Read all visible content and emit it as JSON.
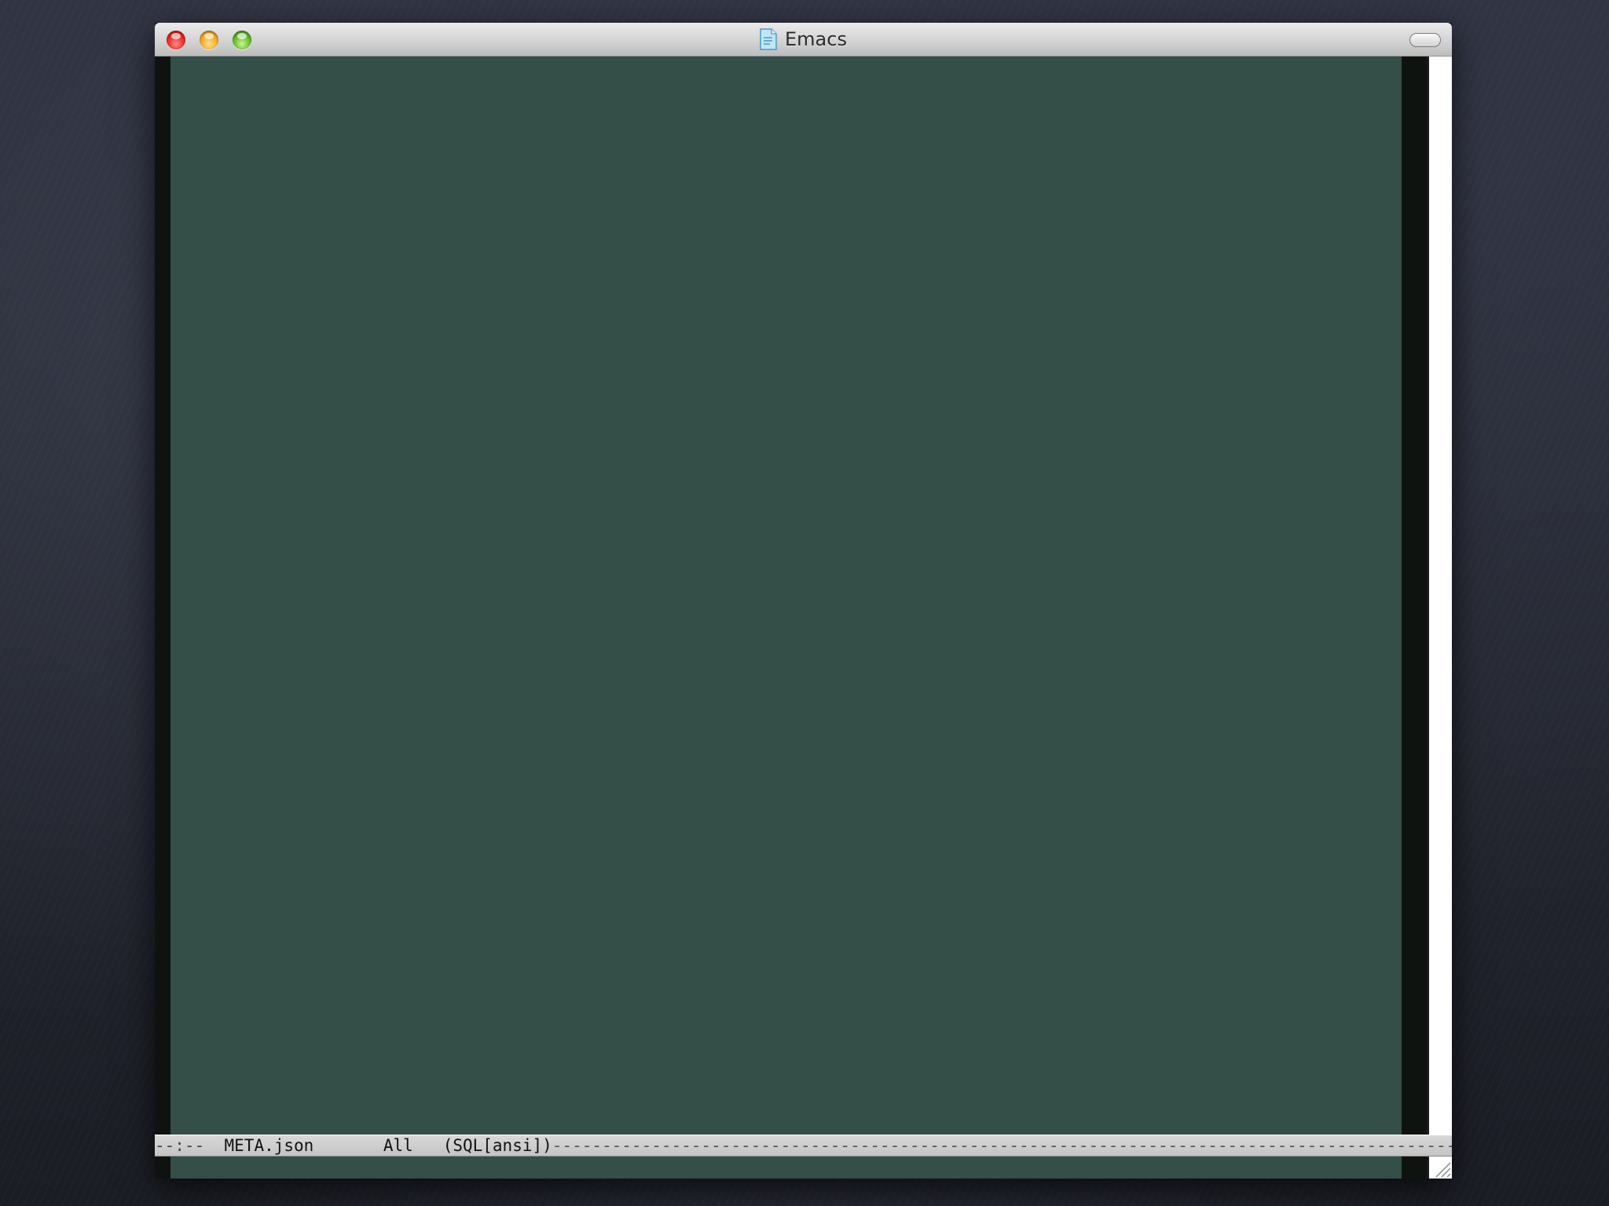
{
  "window": {
    "title": "Emacs",
    "title_icon": "document-icon",
    "buttons": [
      "close",
      "minimize",
      "zoom"
    ]
  },
  "editor": {
    "background_color": "#344e48",
    "fringe_color": "#0f1310"
  },
  "modeline": {
    "status": "--:--",
    "buffer_name": "META.json",
    "position": "All",
    "mode": "(SQL[ansi])",
    "fill": "--------------------------------------------------------------------------------------------------------------------------"
  }
}
